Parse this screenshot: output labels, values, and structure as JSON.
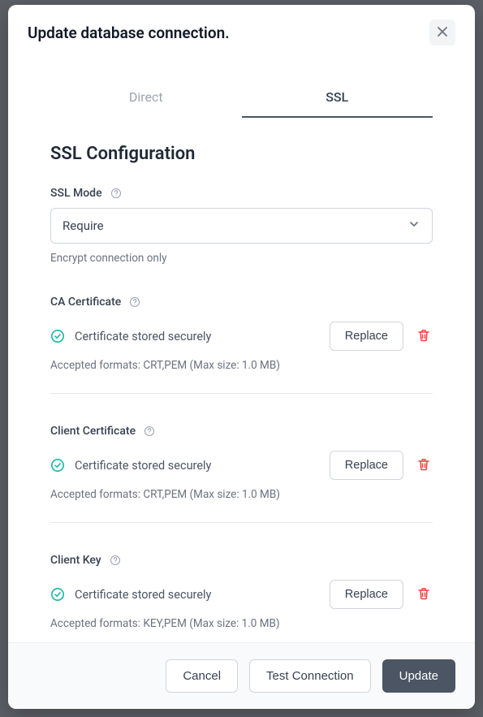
{
  "header": {
    "title": "Update database connection."
  },
  "tabs": {
    "direct": "Direct",
    "ssl": "SSL",
    "active": "ssl"
  },
  "section": {
    "title": "SSL Configuration"
  },
  "sslMode": {
    "label": "SSL Mode",
    "value": "Require",
    "hint": "Encrypt connection only"
  },
  "caCert": {
    "label": "CA Certificate",
    "status": "Certificate stored securely",
    "replace": "Replace",
    "hint": "Accepted formats: CRT,PEM (Max size: 1.0 MB)"
  },
  "clientCert": {
    "label": "Client Certificate",
    "status": "Certificate stored securely",
    "replace": "Replace",
    "hint": "Accepted formats: CRT,PEM (Max size: 1.0 MB)"
  },
  "clientKey": {
    "label": "Client Key",
    "status": "Certificate stored securely",
    "replace": "Replace",
    "hint": "Accepted formats: KEY,PEM (Max size: 1.0 MB)"
  },
  "footer": {
    "cancel": "Cancel",
    "test": "Test Connection",
    "update": "Update"
  }
}
